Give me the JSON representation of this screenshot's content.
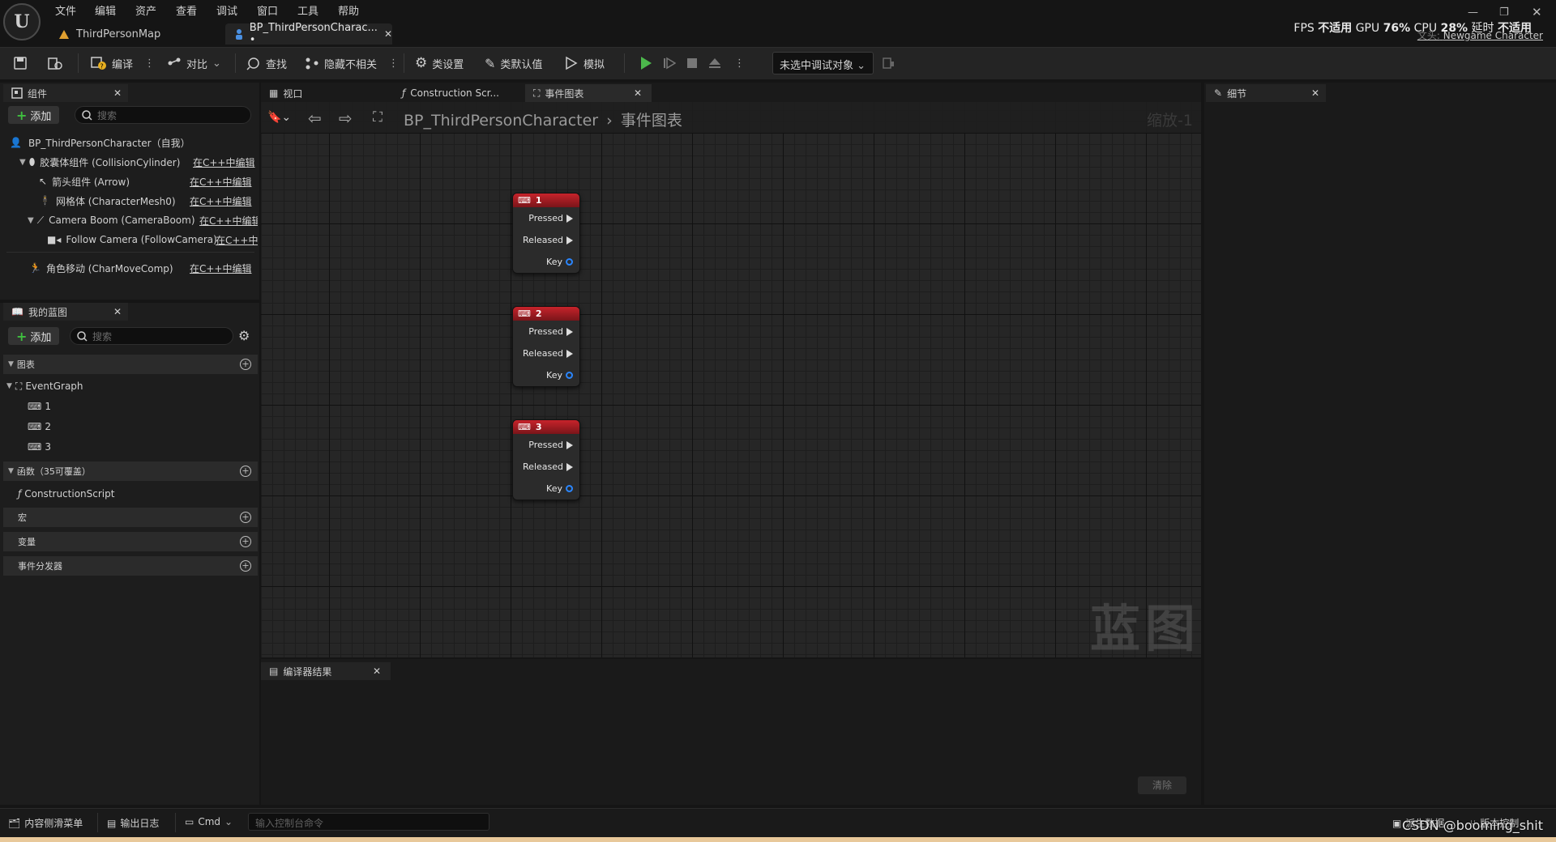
{
  "menu": {
    "items": [
      "文件",
      "编辑",
      "资产",
      "查看",
      "调试",
      "窗口",
      "工具",
      "帮助"
    ]
  },
  "perf": {
    "fps_label": "FPS",
    "fps_value": "不适用",
    "gpu_label": "GPU",
    "gpu_value": "76%",
    "cpu_label": "CPU",
    "cpu_value": "28%",
    "latency_label": "延时",
    "latency_value": "不适用",
    "sub_label": "文头:",
    "sub_link": "Newgame Character"
  },
  "doc_tabs": [
    {
      "label": "ThirdPersonMap"
    },
    {
      "label": "BP_ThirdPersonCharac... •"
    }
  ],
  "toolbar": {
    "compile": "编译",
    "diff": "对比",
    "find": "查找",
    "hide_unrelated": "隐藏不相关",
    "class_settings": "类设置",
    "class_defaults": "类默认值",
    "simulate": "模拟",
    "debug_target": "未选中调试对象"
  },
  "components": {
    "tab_label": "组件",
    "add_label": "添加",
    "search_placeholder": "搜索",
    "root": "BP_ThirdPersonCharacter（自我）",
    "items": [
      {
        "label": "胶囊体组件 (CollisionCylinder)",
        "link": "在C++中编辑"
      },
      {
        "label": "箭头组件 (Arrow)",
        "link": "在C++中编辑"
      },
      {
        "label": "网格体 (CharacterMesh0)",
        "link": "在C++中编辑"
      },
      {
        "label": "Camera Boom (CameraBoom)",
        "link": "在C++中编辑"
      },
      {
        "label": "Follow Camera (FollowCamera)",
        "link": "在C++中"
      },
      {
        "label": "角色移动 (CharMoveComp)",
        "link": "在C++中编辑"
      }
    ]
  },
  "my_blueprint": {
    "tab_label": "我的蓝图",
    "add_label": "添加",
    "search_placeholder": "搜索",
    "graphs_section": "图表",
    "event_graph": "EventGraph",
    "graph_items": [
      "1",
      "2",
      "3"
    ],
    "functions_section": "函数（35可覆盖）",
    "construction_script": "ConstructionScript",
    "macros_section": "宏",
    "variables_section": "变量",
    "dispatchers_section": "事件分发器"
  },
  "center_tabs": [
    {
      "label": "视口"
    },
    {
      "label": "Construction Scr..."
    },
    {
      "label": "事件图表"
    }
  ],
  "breadcrumb": {
    "root": "BP_ThirdPersonCharacter",
    "current": "事件图表"
  },
  "zoom": "缩放-1",
  "nodes": [
    {
      "title": "1",
      "pins": [
        "Pressed",
        "Released",
        "Key"
      ]
    },
    {
      "title": "2",
      "pins": [
        "Pressed",
        "Released",
        "Key"
      ]
    },
    {
      "title": "3",
      "pins": [
        "Pressed",
        "Released",
        "Key"
      ]
    }
  ],
  "watermark": "蓝图",
  "compiler": {
    "tab_label": "编译器结果",
    "clear_label": "清除"
  },
  "details": {
    "tab_label": "细节"
  },
  "statusbar": {
    "content_drawer": "内容侧滑菜单",
    "output_log": "输出日志",
    "cmd": "Cmd",
    "console_placeholder": "输入控制台命令",
    "source_control": "派生数据",
    "revision_control": "版本控制",
    "watermark_text": "CSDN @booming_shit"
  }
}
